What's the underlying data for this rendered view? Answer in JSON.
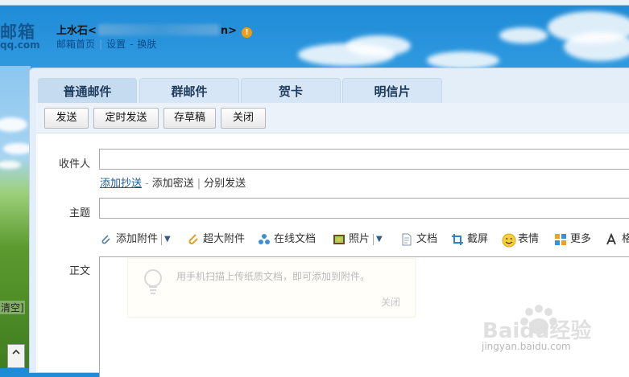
{
  "header": {
    "logo_text": "邮箱",
    "logo_sub": "qq.com",
    "user_prefix": "上水石<",
    "user_suffix": "n>",
    "warning_icon": "exclamation-circle-icon",
    "links": [
      "邮箱首页",
      "设置",
      "换肤"
    ]
  },
  "left": {
    "clear_text": "清空]",
    "scroll_up_icon": "chevron-up-icon"
  },
  "tabs": [
    {
      "label": "普通邮件",
      "active": true
    },
    {
      "label": "群邮件",
      "active": false
    },
    {
      "label": "贺卡",
      "active": false
    },
    {
      "label": "明信片",
      "active": false
    }
  ],
  "toolbar": {
    "send": "发送",
    "schedule_send": "定时发送",
    "save_draft": "存草稿",
    "close": "关闭"
  },
  "form": {
    "to_label": "收件人",
    "to_value": "",
    "add_cc": "添加抄送",
    "add_bcc": "添加密送",
    "separate_send": "分别发送",
    "subject_label": "主题",
    "subject_value": "",
    "body_label": "正文"
  },
  "attachments": {
    "add_attachment": "添加附件",
    "large_attachment": "超大附件",
    "online_doc": "在线文档",
    "photo": "照片",
    "document": "文档",
    "screenshot": "截屏",
    "emoji": "表情",
    "more": "更多",
    "format": "格"
  },
  "tip": {
    "text": "用手机扫描上传纸质文档，即可添加到附件。",
    "close": "关闭"
  },
  "watermark": {
    "brand": "Baidu经验",
    "url": "jingyan.baidu.com"
  },
  "colors": {
    "accent": "#15568f",
    "tab_bg": "#d6e6f6",
    "toolbar_bg": "#ebf2fa"
  }
}
